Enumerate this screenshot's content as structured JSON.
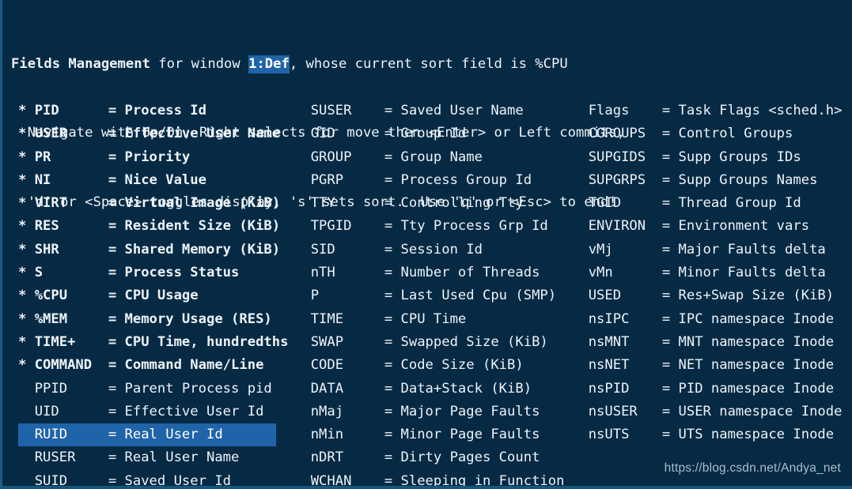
{
  "header": {
    "line1_prefix": "Fields Management",
    "line1_mid": " for window ",
    "line1_window": "1:Def",
    "line1_suffix": ", whose current sort field is %CPU",
    "line2": "  Navigate with Up/Dn, Right selects for move then <Enter> or Left commits,",
    "line3": "  'd' or <Space> toggles display, 's' sets sort.  Use 'q' or <Esc> to end!"
  },
  "colors": {
    "background": "#062a44",
    "foreground": "#eef3f8",
    "highlight_bg": "#1f64a8",
    "highlight_fg": "#ffffff",
    "border": "#1c5b85",
    "watermark": "#a9bdcd"
  },
  "selected_field": "RUID",
  "columns": [
    {
      "name": "column-1",
      "rows": [
        {
          "mark": "*",
          "field": "PID",
          "eq": "=",
          "desc": "Process Id",
          "on": true,
          "selected": false
        },
        {
          "mark": "*",
          "field": "USER",
          "eq": "=",
          "desc": "Effective User Name",
          "on": true,
          "selected": false
        },
        {
          "mark": "*",
          "field": "PR",
          "eq": "=",
          "desc": "Priority",
          "on": true,
          "selected": false
        },
        {
          "mark": "*",
          "field": "NI",
          "eq": "=",
          "desc": "Nice Value",
          "on": true,
          "selected": false
        },
        {
          "mark": "*",
          "field": "VIRT",
          "eq": "=",
          "desc": "Virtual Image (KiB)",
          "on": true,
          "selected": false
        },
        {
          "mark": "*",
          "field": "RES",
          "eq": "=",
          "desc": "Resident Size (KiB)",
          "on": true,
          "selected": false
        },
        {
          "mark": "*",
          "field": "SHR",
          "eq": "=",
          "desc": "Shared Memory (KiB)",
          "on": true,
          "selected": false
        },
        {
          "mark": "*",
          "field": "S",
          "eq": "=",
          "desc": "Process Status",
          "on": true,
          "selected": false
        },
        {
          "mark": "*",
          "field": "%CPU",
          "eq": "=",
          "desc": "CPU Usage",
          "on": true,
          "selected": false
        },
        {
          "mark": "*",
          "field": "%MEM",
          "eq": "=",
          "desc": "Memory Usage (RES)",
          "on": true,
          "selected": false
        },
        {
          "mark": "*",
          "field": "TIME+",
          "eq": "=",
          "desc": "CPU Time, hundredths",
          "on": true,
          "selected": false
        },
        {
          "mark": "*",
          "field": "COMMAND",
          "eq": "=",
          "desc": "Command Name/Line",
          "on": true,
          "selected": false
        },
        {
          "mark": " ",
          "field": "PPID",
          "eq": "=",
          "desc": "Parent Process pid",
          "on": false,
          "selected": false
        },
        {
          "mark": " ",
          "field": "UID",
          "eq": "=",
          "desc": "Effective User Id",
          "on": false,
          "selected": false
        },
        {
          "mark": " ",
          "field": "RUID",
          "eq": "=",
          "desc": "Real User Id",
          "on": false,
          "selected": true
        },
        {
          "mark": " ",
          "field": "RUSER",
          "eq": "=",
          "desc": "Real User Name",
          "on": false,
          "selected": false
        },
        {
          "mark": " ",
          "field": "SUID",
          "eq": "=",
          "desc": "Saved User Id",
          "on": false,
          "selected": false
        }
      ]
    },
    {
      "name": "column-2",
      "rows": [
        {
          "mark": " ",
          "field": "SUSER",
          "eq": "=",
          "desc": "Saved User Name",
          "on": false,
          "selected": false
        },
        {
          "mark": " ",
          "field": "GID",
          "eq": "=",
          "desc": "Group Id",
          "on": false,
          "selected": false
        },
        {
          "mark": " ",
          "field": "GROUP",
          "eq": "=",
          "desc": "Group Name",
          "on": false,
          "selected": false
        },
        {
          "mark": " ",
          "field": "PGRP",
          "eq": "=",
          "desc": "Process Group Id",
          "on": false,
          "selected": false
        },
        {
          "mark": " ",
          "field": "TTY",
          "eq": "=",
          "desc": "Controlling Tty",
          "on": false,
          "selected": false
        },
        {
          "mark": " ",
          "field": "TPGID",
          "eq": "=",
          "desc": "Tty Process Grp Id",
          "on": false,
          "selected": false
        },
        {
          "mark": " ",
          "field": "SID",
          "eq": "=",
          "desc": "Session Id",
          "on": false,
          "selected": false
        },
        {
          "mark": " ",
          "field": "nTH",
          "eq": "=",
          "desc": "Number of Threads",
          "on": false,
          "selected": false
        },
        {
          "mark": " ",
          "field": "P",
          "eq": "=",
          "desc": "Last Used Cpu (SMP)",
          "on": false,
          "selected": false
        },
        {
          "mark": " ",
          "field": "TIME",
          "eq": "=",
          "desc": "CPU Time",
          "on": false,
          "selected": false
        },
        {
          "mark": " ",
          "field": "SWAP",
          "eq": "=",
          "desc": "Swapped Size (KiB)",
          "on": false,
          "selected": false
        },
        {
          "mark": " ",
          "field": "CODE",
          "eq": "=",
          "desc": "Code Size (KiB)",
          "on": false,
          "selected": false
        },
        {
          "mark": " ",
          "field": "DATA",
          "eq": "=",
          "desc": "Data+Stack (KiB)",
          "on": false,
          "selected": false
        },
        {
          "mark": " ",
          "field": "nMaj",
          "eq": "=",
          "desc": "Major Page Faults",
          "on": false,
          "selected": false
        },
        {
          "mark": " ",
          "field": "nMin",
          "eq": "=",
          "desc": "Minor Page Faults",
          "on": false,
          "selected": false
        },
        {
          "mark": " ",
          "field": "nDRT",
          "eq": "=",
          "desc": "Dirty Pages Count",
          "on": false,
          "selected": false
        },
        {
          "mark": " ",
          "field": "WCHAN",
          "eq": "=",
          "desc": "Sleeping in Function",
          "on": false,
          "selected": false
        }
      ]
    },
    {
      "name": "column-3",
      "rows": [
        {
          "mark": " ",
          "field": "Flags",
          "eq": "=",
          "desc": "Task Flags <sched.h>",
          "on": false,
          "selected": false
        },
        {
          "mark": " ",
          "field": "CGROUPS",
          "eq": "=",
          "desc": "Control Groups",
          "on": false,
          "selected": false
        },
        {
          "mark": " ",
          "field": "SUPGIDS",
          "eq": "=",
          "desc": "Supp Groups IDs",
          "on": false,
          "selected": false
        },
        {
          "mark": " ",
          "field": "SUPGRPS",
          "eq": "=",
          "desc": "Supp Groups Names",
          "on": false,
          "selected": false
        },
        {
          "mark": " ",
          "field": "TGID",
          "eq": "=",
          "desc": "Thread Group Id",
          "on": false,
          "selected": false
        },
        {
          "mark": " ",
          "field": "ENVIRON",
          "eq": "=",
          "desc": "Environment vars",
          "on": false,
          "selected": false
        },
        {
          "mark": " ",
          "field": "vMj",
          "eq": "=",
          "desc": "Major Faults delta",
          "on": false,
          "selected": false
        },
        {
          "mark": " ",
          "field": "vMn",
          "eq": "=",
          "desc": "Minor Faults delta",
          "on": false,
          "selected": false
        },
        {
          "mark": " ",
          "field": "USED",
          "eq": "=",
          "desc": "Res+Swap Size (KiB)",
          "on": false,
          "selected": false
        },
        {
          "mark": " ",
          "field": "nsIPC",
          "eq": "=",
          "desc": "IPC namespace Inode",
          "on": false,
          "selected": false
        },
        {
          "mark": " ",
          "field": "nsMNT",
          "eq": "=",
          "desc": "MNT namespace Inode",
          "on": false,
          "selected": false
        },
        {
          "mark": " ",
          "field": "nsNET",
          "eq": "=",
          "desc": "NET namespace Inode",
          "on": false,
          "selected": false
        },
        {
          "mark": " ",
          "field": "nsPID",
          "eq": "=",
          "desc": "PID namespace Inode",
          "on": false,
          "selected": false
        },
        {
          "mark": " ",
          "field": "nsUSER",
          "eq": "=",
          "desc": "USER namespace Inode",
          "on": false,
          "selected": false
        },
        {
          "mark": " ",
          "field": "nsUTS",
          "eq": "=",
          "desc": "UTS namespace Inode",
          "on": false,
          "selected": false
        }
      ]
    }
  ],
  "watermark": "https://blog.csdn.net/Andya_net"
}
